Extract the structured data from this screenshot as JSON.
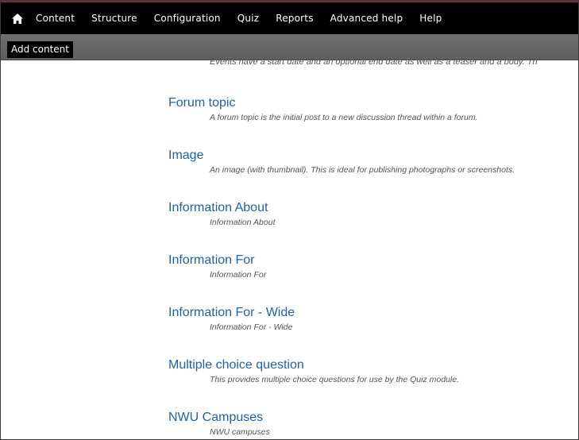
{
  "toolbar": {
    "home_icon": "home-icon",
    "menu": [
      {
        "label": "Content"
      },
      {
        "label": "Structure"
      },
      {
        "label": "Configuration"
      },
      {
        "label": "Quiz"
      },
      {
        "label": "Reports"
      },
      {
        "label": "Advanced help"
      },
      {
        "label": "Help"
      }
    ]
  },
  "shortcuts": {
    "add_content": "Add content"
  },
  "content": {
    "cut_text": "Events have a start date and an optional end date as well as a teaser and a body. Th",
    "types": [
      {
        "title": "Forum topic",
        "description": "A forum topic is the initial post to a new discussion thread within a forum."
      },
      {
        "title": "Image",
        "description": "An image (with thumbnail). This is ideal for publishing photographs or screenshots."
      },
      {
        "title": "Information About",
        "description": "Information About"
      },
      {
        "title": "Information For",
        "description": "Information For"
      },
      {
        "title": "Information For - Wide",
        "description": "Information For - Wide"
      },
      {
        "title": "Multiple choice question",
        "description": "This provides multiple choice questions for use by the Quiz module."
      },
      {
        "title": "NWU Campuses",
        "description": "NWU campuses"
      }
    ]
  },
  "colors": {
    "toolbar_bg": "#000000",
    "shortcut_bar_bg": "#666666",
    "link": "#1f62a8",
    "description": "#555555",
    "accent": "#7a2a35"
  }
}
